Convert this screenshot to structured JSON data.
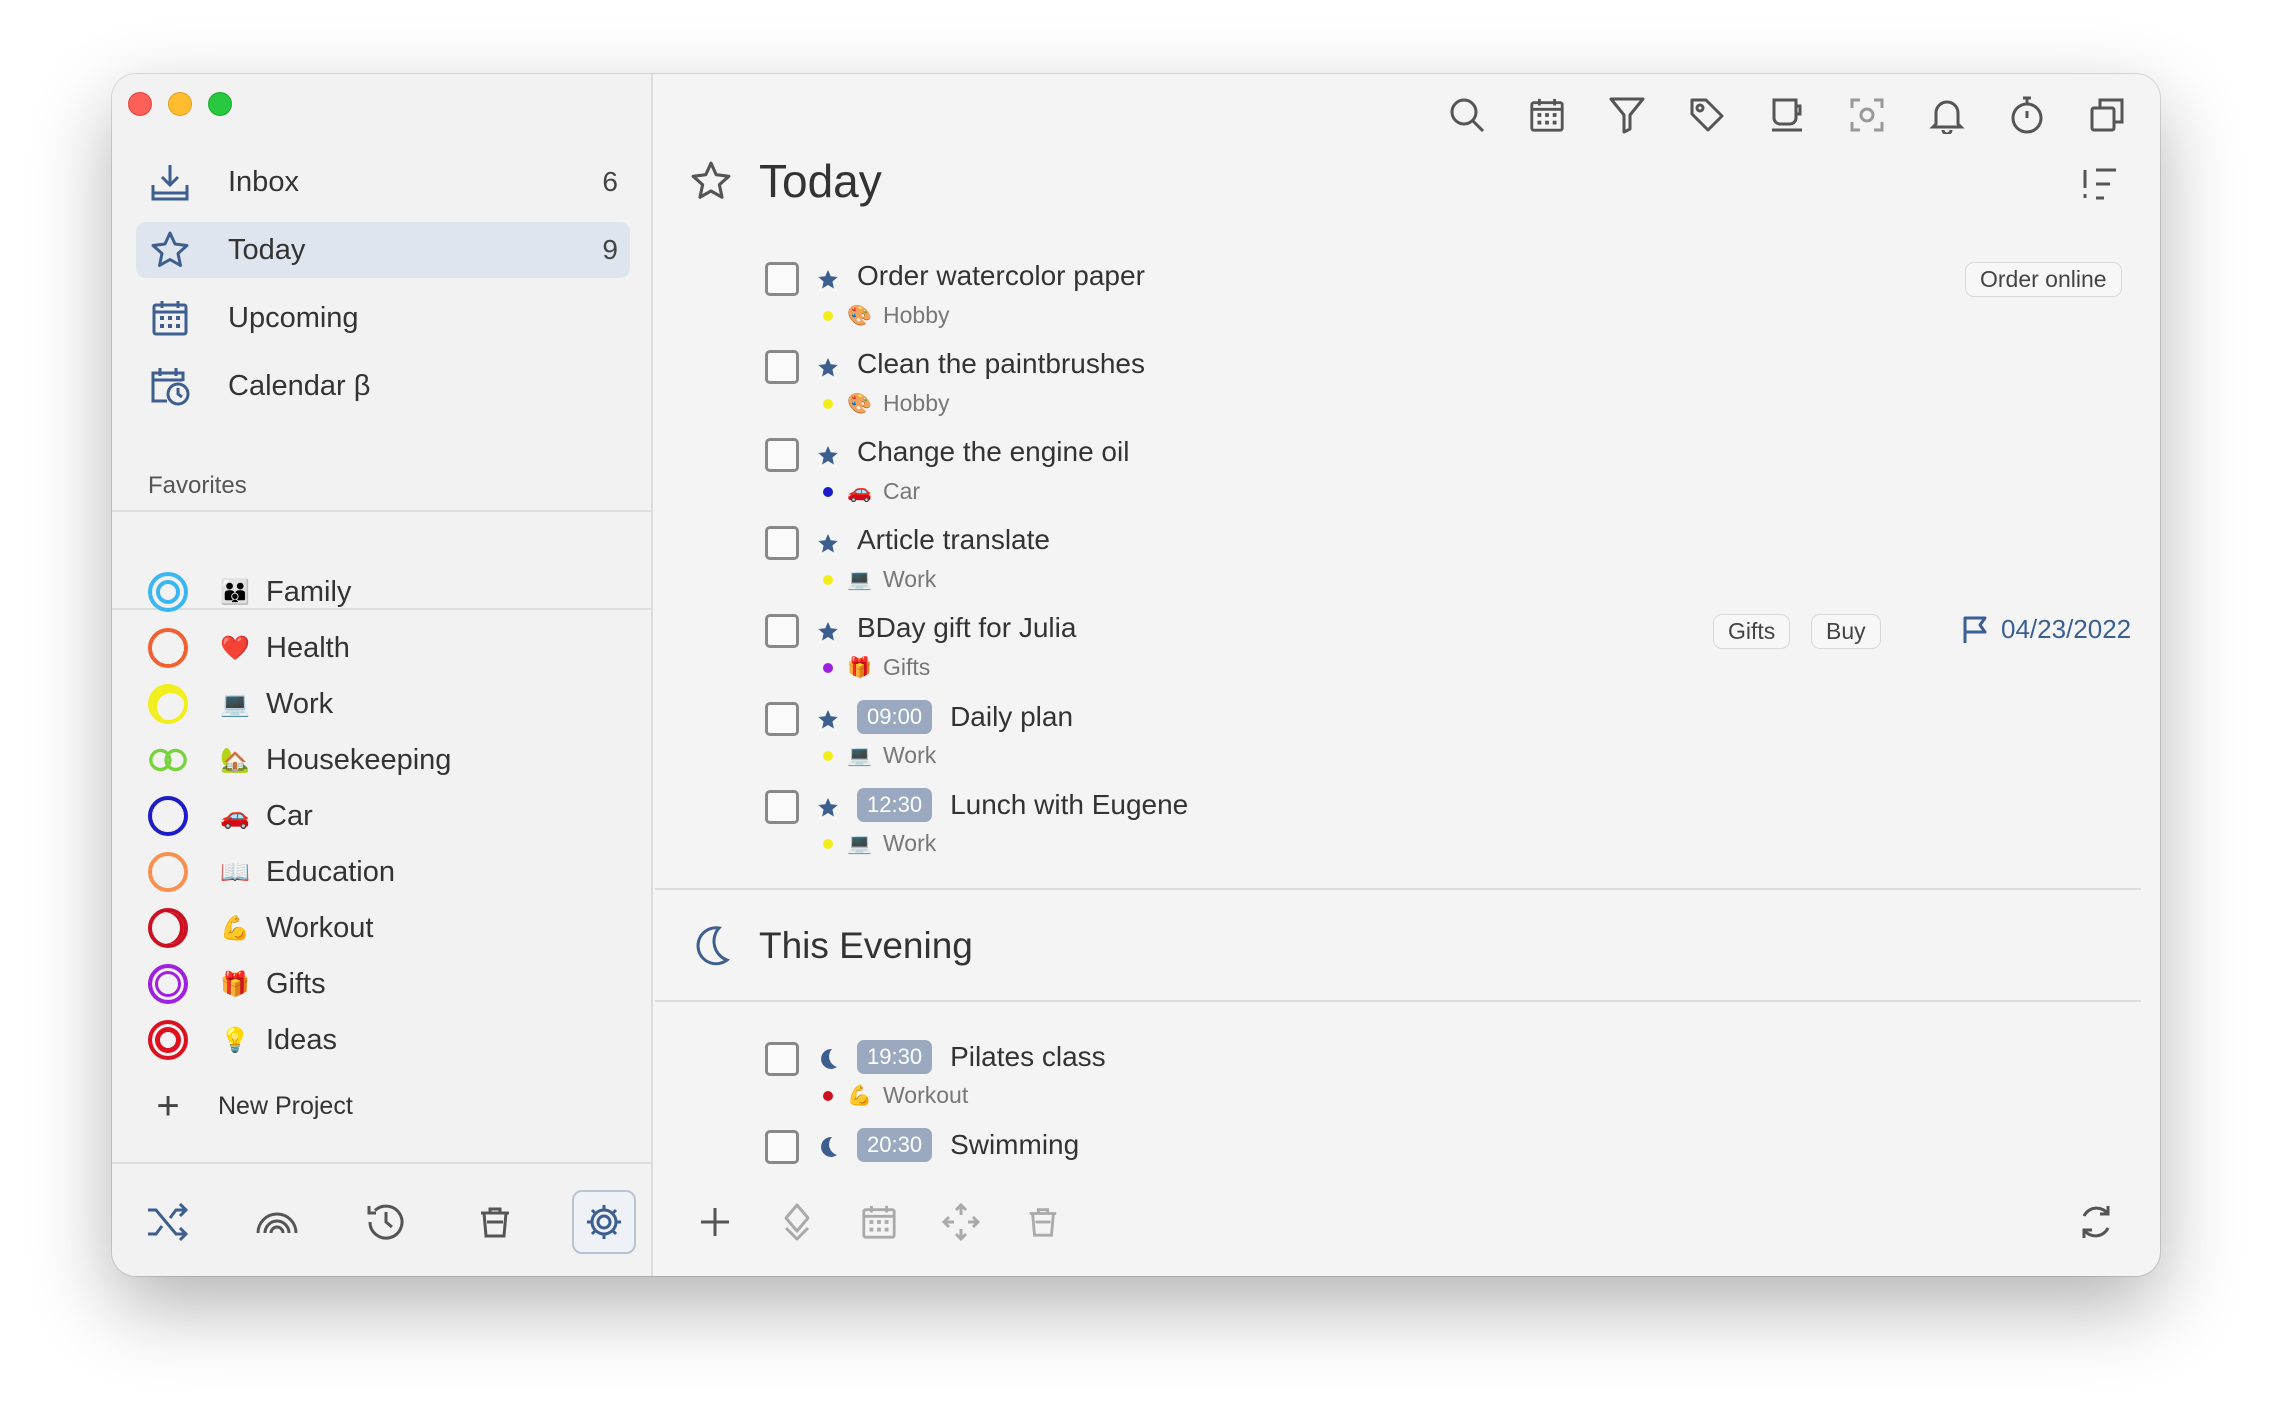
{
  "nav": [
    {
      "label": "Inbox",
      "count": "6"
    },
    {
      "label": "Today",
      "count": "9"
    },
    {
      "label": "Upcoming",
      "count": ""
    },
    {
      "label": "Calendar β",
      "count": ""
    }
  ],
  "favorites_title": "Favorites",
  "projects": [
    {
      "name": "Family",
      "emoji": "👪",
      "color": "#3ab7f0"
    },
    {
      "name": "Health",
      "emoji": "❤️",
      "color": "#f06030"
    },
    {
      "name": "Work",
      "emoji": "💻",
      "color": "#f2ee1a"
    },
    {
      "name": "Housekeeping",
      "emoji": "🏡",
      "color": "#78d23c"
    },
    {
      "name": "Car",
      "emoji": "🚗",
      "color": "#1c1cc8"
    },
    {
      "name": "Education",
      "emoji": "📖",
      "color": "#f89050"
    },
    {
      "name": "Workout",
      "emoji": "💪",
      "color": "#cc1020"
    },
    {
      "name": "Gifts",
      "emoji": "🎁",
      "color": "#a020e0"
    },
    {
      "name": "Ideas",
      "emoji": "💡",
      "color": "#dd1020"
    }
  ],
  "new_project_label": "New Project",
  "today_title": "Today",
  "evening_title": "This Evening",
  "tasks": [
    {
      "title": "Order watercolor paper",
      "time": "",
      "project": "Hobby",
      "emoji": "🎨",
      "dot": "#f2ee1a",
      "tags": [
        "Order online"
      ],
      "due": ""
    },
    {
      "title": "Clean the paintbrushes",
      "time": "",
      "project": "Hobby",
      "emoji": "🎨",
      "dot": "#f2ee1a",
      "tags": [],
      "due": ""
    },
    {
      "title": "Change the engine oil",
      "time": "",
      "project": "Car",
      "emoji": "🚗",
      "dot": "#1c1cc8",
      "tags": [],
      "due": ""
    },
    {
      "title": "Article translate",
      "time": "",
      "project": "Work",
      "emoji": "💻",
      "dot": "#f2ee1a",
      "tags": [],
      "due": ""
    },
    {
      "title": "BDay gift for Julia",
      "time": "",
      "project": "Gifts",
      "emoji": "🎁",
      "dot": "#a020e0",
      "tags": [
        "Gifts",
        "Buy"
      ],
      "due": "04/23/2022"
    },
    {
      "title": "Daily plan",
      "time": "09:00",
      "project": "Work",
      "emoji": "💻",
      "dot": "#f2ee1a",
      "tags": [],
      "due": ""
    },
    {
      "title": "Lunch with Eugene",
      "time": "12:30",
      "project": "Work",
      "emoji": "💻",
      "dot": "#f2ee1a",
      "tags": [],
      "due": ""
    }
  ],
  "evening_tasks": [
    {
      "title": "Pilates class",
      "time": "19:30",
      "project": "Workout",
      "emoji": "💪",
      "dot": "#cc1020"
    },
    {
      "title": "Swimming",
      "time": "20:30",
      "project": "",
      "emoji": "",
      "dot": ""
    }
  ],
  "colors": {
    "accent": "#3a5f93",
    "selected_bg": "#dfe5ee",
    "time_badge": "#9aa9bf"
  }
}
